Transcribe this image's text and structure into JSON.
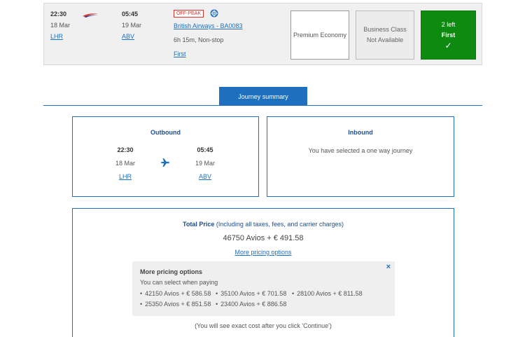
{
  "flight": {
    "depart_time": "22:30",
    "depart_date": "18 Mar",
    "depart_code": "LHR",
    "arrive_time": "05:45",
    "arrive_date": "19 Mar",
    "arrive_code": "ABV",
    "badge": "OFF-PEAK",
    "flight_link": "British Airways - BA0083",
    "duration": "6h 15m, Non-stop",
    "cabin_link": "First"
  },
  "cabins": [
    {
      "label": "Premium Economy"
    },
    {
      "label": "Business Class",
      "status": "Not Available"
    },
    {
      "seats_left": "2 left",
      "label": "First",
      "check": "✓"
    }
  ],
  "tab": {
    "label": "Journey summary"
  },
  "outbound": {
    "title": "Outbound",
    "depart_time": "22:30",
    "depart_date": "18 Mar",
    "depart_code": "LHR",
    "arrive_time": "05:45",
    "arrive_date": "19 Mar",
    "arrive_code": "ABV"
  },
  "inbound": {
    "title": "Inbound",
    "message": "You have selected a one way journey"
  },
  "price": {
    "title_bold": "Total Price",
    "title_rest": " (Including all taxes, fees, and carrier charges)",
    "amount": "46750 Avios + € 491.58",
    "more_link": "More pricing options",
    "more_title": "More pricing options",
    "more_sub": "You can select when paying",
    "close": "×",
    "options": [
      "42150 Avios + € 586.58",
      "35100 Avios + € 701.58",
      "28100 Avios + € 811.58",
      "25350 Avios + € 851.58",
      "23400 Avios + € 886.58"
    ],
    "note": "(You will see exact cost after you click 'Continue')"
  },
  "colors": {
    "accent": "#1e6fbd",
    "selected": "#0f8a10",
    "offpeak": "#d9342b"
  }
}
